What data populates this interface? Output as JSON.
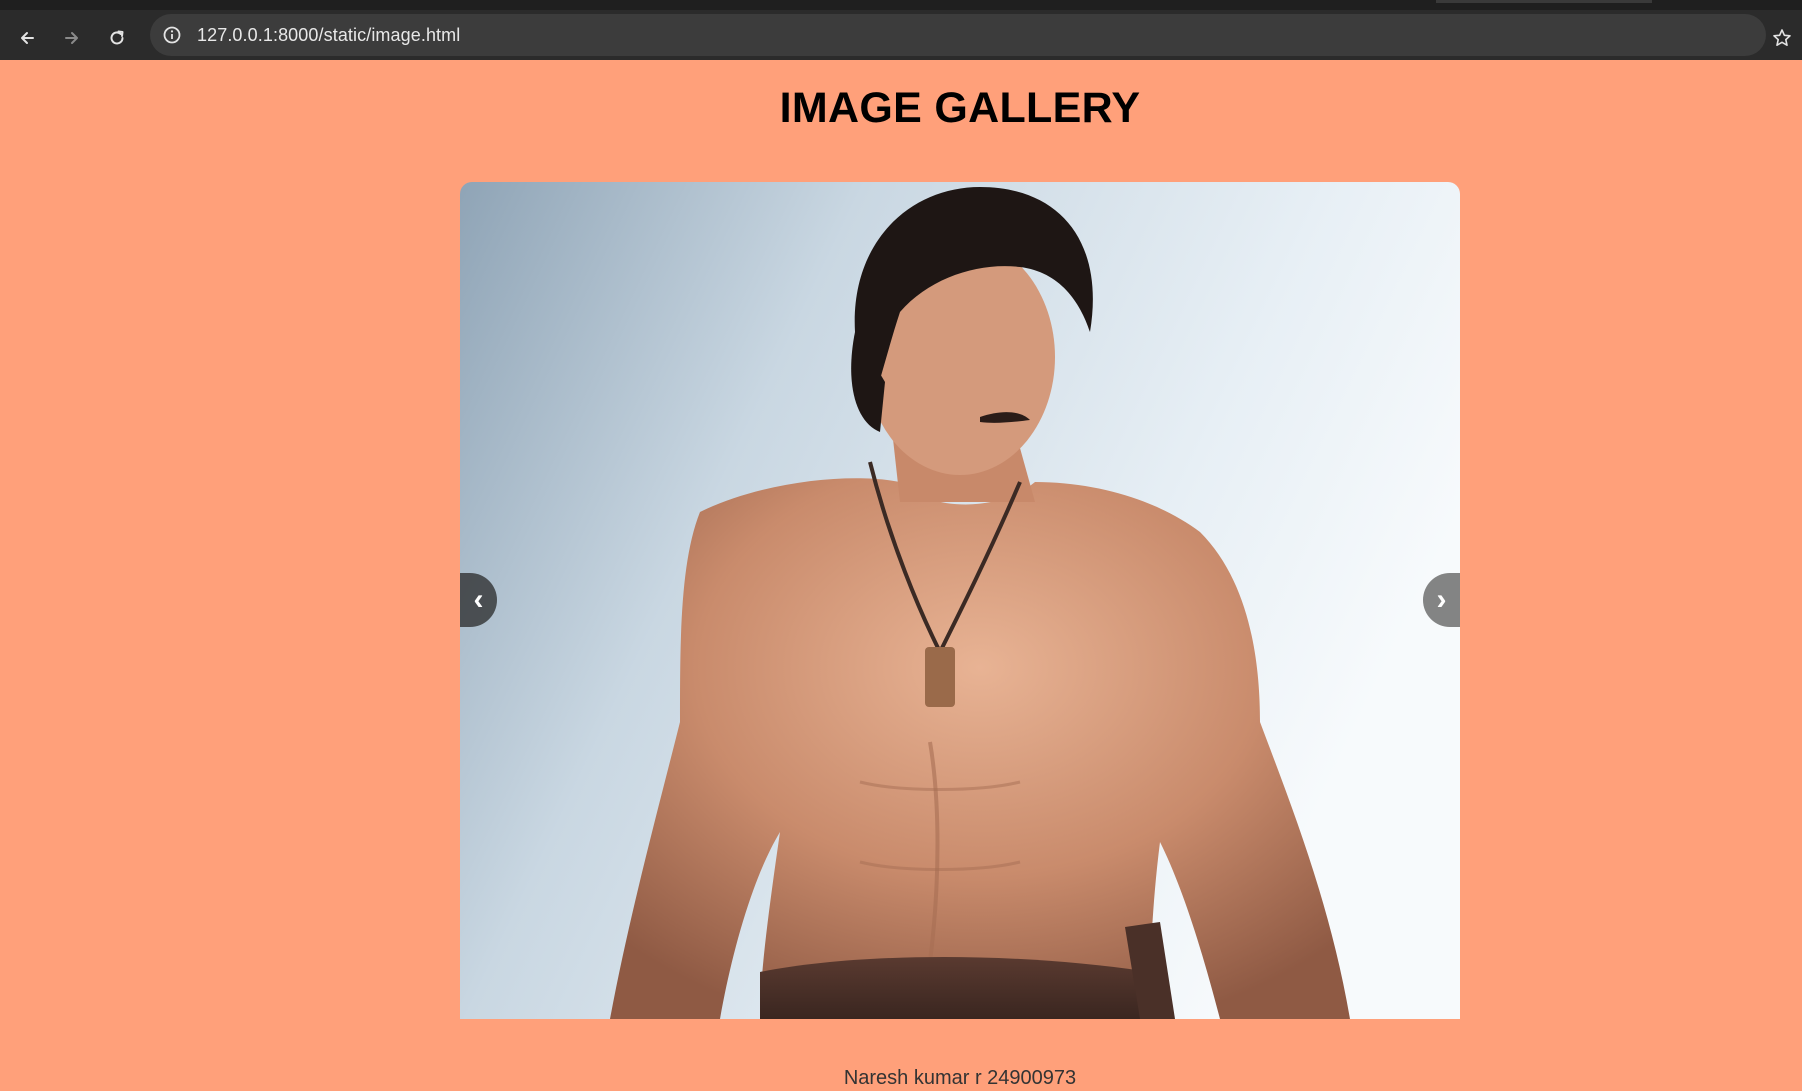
{
  "browser": {
    "url": "127.0.0.1:8000/static/image.html",
    "icons": {
      "back": "back-arrow-icon",
      "forward": "forward-arrow-icon",
      "reload": "reload-icon",
      "site_info": "info-icon",
      "bookmark": "star-icon"
    }
  },
  "page": {
    "title": "IMAGE GALLERY",
    "background_color": "#ffa07a",
    "gallery": {
      "prev_label": "‹",
      "next_label": "›",
      "image_description": "Photo: shirtless man with long dark hair and a pendant necklace against a cloudy sky"
    },
    "caption": "Naresh kumar r 24900973"
  }
}
